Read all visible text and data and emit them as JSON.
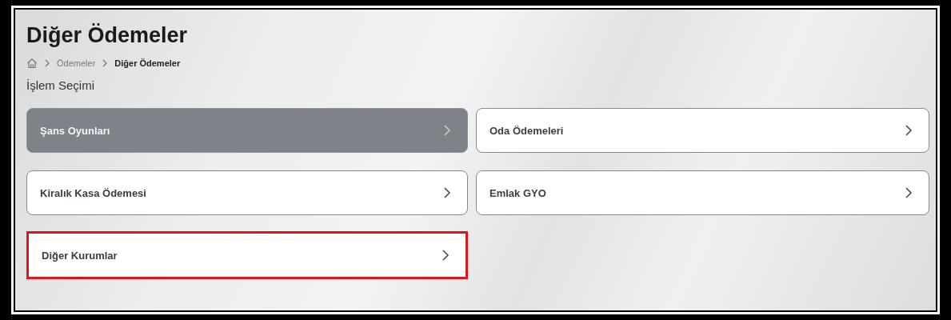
{
  "page": {
    "title": "Diğer Ödemeler"
  },
  "breadcrumb": [
    {
      "label": "Ödemeler",
      "current": false
    },
    {
      "label": "Diğer Ödemeler",
      "current": true
    }
  ],
  "section_label": "İşlem Seçimi",
  "options": [
    {
      "label": "Şans Oyunları",
      "disabled": true,
      "highlighted": false
    },
    {
      "label": "Oda Ödemeleri",
      "disabled": false,
      "highlighted": false
    },
    {
      "label": "Kiralık Kasa Ödemesi",
      "disabled": false,
      "highlighted": false
    },
    {
      "label": "Emlak GYO",
      "disabled": false,
      "highlighted": false
    },
    {
      "label": "Diğer Kurumlar",
      "disabled": false,
      "highlighted": true
    }
  ]
}
